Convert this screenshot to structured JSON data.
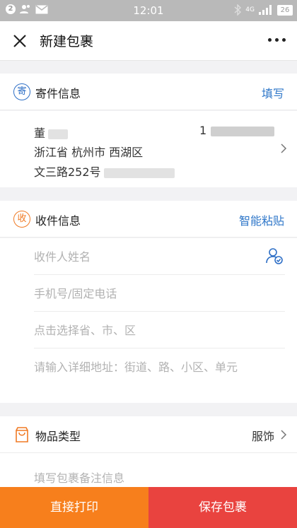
{
  "status_bar": {
    "notif_count": "2",
    "time": "12:01",
    "network": "4G",
    "battery": "26"
  },
  "nav": {
    "title": "新建包裹",
    "close_icon": "close-icon",
    "more_icon": "more-icon"
  },
  "sender": {
    "icon_char": "寄",
    "title": "寄件信息",
    "action": "填写",
    "name": "董",
    "phone": "1",
    "region": "浙江省 杭州市 西湖区",
    "address": "文三路252号"
  },
  "receiver": {
    "icon_char": "收",
    "title": "收件信息",
    "action": "智能粘贴",
    "name_placeholder": "收件人姓名",
    "phone_placeholder": "手机号/固定电话",
    "region_placeholder": "点击选择省、市、区",
    "address_placeholder": "请输入详细地址：街道、路、小区、单元"
  },
  "goods": {
    "title": "物品类型",
    "value": "服饰"
  },
  "remark": {
    "placeholder": "填写包裹备注信息"
  },
  "actions": {
    "print": "直接打印",
    "save": "保存包裹"
  },
  "colors": {
    "accent_blue": "#2f77c9",
    "accent_orange": "#f07a24",
    "print_button": "#f77f1c",
    "save_button": "#e9433f"
  }
}
